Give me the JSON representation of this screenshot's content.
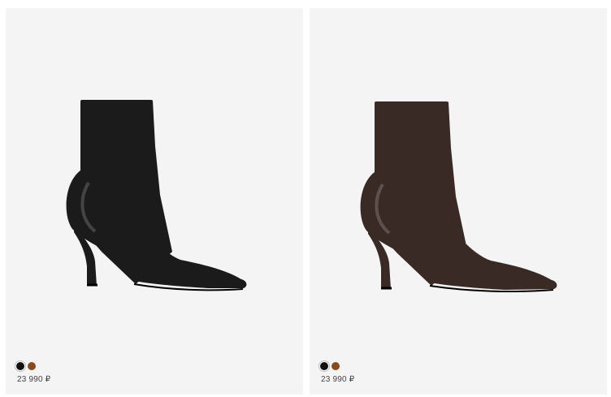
{
  "products": [
    {
      "price": "23 990 ₽",
      "boot_color": "#1b1b1b",
      "swatches": [
        {
          "color": "#111111",
          "selected": true
        },
        {
          "color": "#8a4a1c",
          "selected": false
        }
      ]
    },
    {
      "price": "23 990 ₽",
      "boot_color": "#3a2a26",
      "swatches": [
        {
          "color": "#111111",
          "selected": true
        },
        {
          "color": "#8a4a1c",
          "selected": false
        }
      ]
    }
  ]
}
